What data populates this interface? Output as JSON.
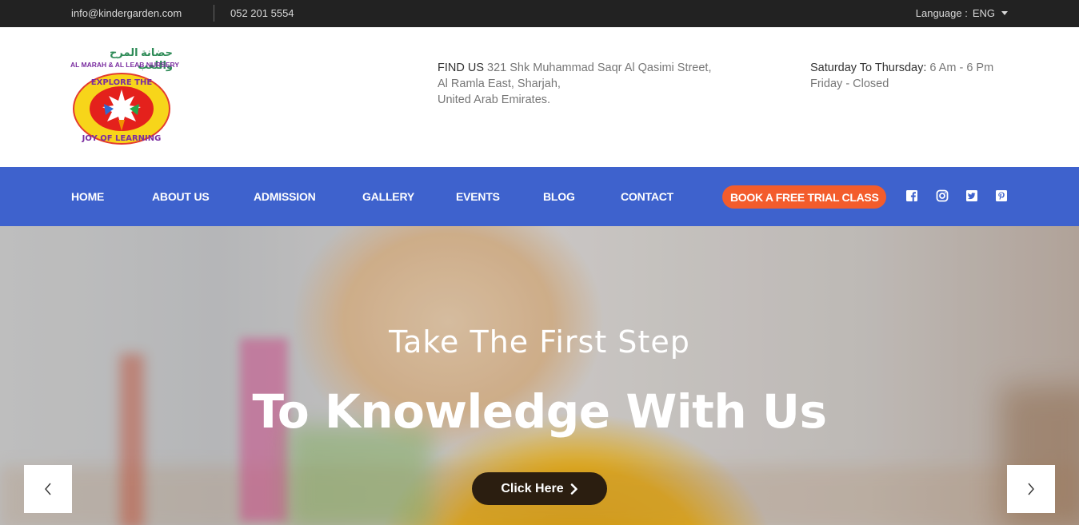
{
  "topbar": {
    "email": "info@kindergarden.com",
    "phone": "052 201 5554",
    "language_label": "Language :",
    "language_value": "ENG"
  },
  "header": {
    "logo": {
      "arabic_text": "حضانة المرح واللعب",
      "english_text": "AL MARAH & AL LEAB NURSERY",
      "badge_text": "EXPLORE THE JOY OF LEARNING"
    },
    "find_us": {
      "label": "FIND US",
      "line1": "321 Shk Muhammad Saqr Al Qasimi Street,",
      "line2": "Al Ramla East, Sharjah,",
      "line3": "United Arab Emirates."
    },
    "hours": {
      "label": "Saturday To Thursday:",
      "value": "6 Am - 6 Pm",
      "closed": "Friday - Closed"
    }
  },
  "nav": {
    "items": [
      {
        "label": "HOME"
      },
      {
        "label": "ABOUT US"
      },
      {
        "label": "ADMISSION"
      },
      {
        "label": "GALLERY"
      },
      {
        "label": "EVENTS"
      },
      {
        "label": "BLOG"
      },
      {
        "label": "CONTACT"
      }
    ],
    "cta": "BOOK A FREE TRIAL CLASS",
    "social": [
      "facebook-icon",
      "instagram-icon",
      "twitter-icon",
      "pinterest-icon"
    ]
  },
  "hero": {
    "subtitle": "Take The First Step",
    "title": "To Knowledge With Us",
    "button": "Click Here"
  },
  "colors": {
    "topbar_bg": "#222222",
    "nav_bg": "#3e62cd",
    "cta_bg": "#f35c2c",
    "hero_button_bg": "#2b1e10"
  }
}
